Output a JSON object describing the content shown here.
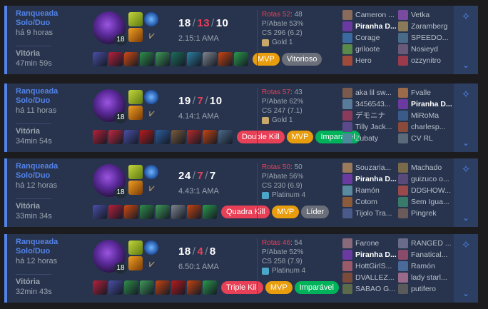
{
  "matches": [
    {
      "queue": "Ranqueada Solo/Duo",
      "ago": "há 9 horas",
      "result": "Vitória",
      "duration": "47min 59s",
      "level": "18",
      "kills": "18",
      "deaths": "13",
      "assists": "10",
      "ratio": "2.15:1 AMA",
      "badges": [
        {
          "label": "MVP",
          "class": "b-mvp"
        },
        {
          "label": "Vitorioso",
          "class": "b-gray"
        }
      ],
      "rotas_label": "Rotas 52",
      "rotas_rest": ": 48",
      "pabate": "P/Abate 53%",
      "cs": "CS 296 (6.2)",
      "rank": "Gold 1",
      "rank_color": "#c9a86b",
      "items": [
        "#4a4fa8",
        "#b8203a",
        "#d04a12",
        "#2e8e4a",
        "#3e9a58",
        "#1c6e5a",
        "#2c7fa0",
        "#7e8690",
        "#c84410",
        "#2a9a4c"
      ],
      "team1": [
        {
          "name": "Cameron ...",
          "c": "#8a6a5a"
        },
        {
          "name": "Piranha D...",
          "c": "#6a3aa0",
          "me": true
        },
        {
          "name": "Corage",
          "c": "#3a6aa0"
        },
        {
          "name": "griloote",
          "c": "#5a8a4a"
        },
        {
          "name": "Hero",
          "c": "#a04a3a"
        }
      ],
      "team2": [
        {
          "name": "Vetka",
          "c": "#7a4aa0"
        },
        {
          "name": "Zaramberg",
          "c": "#8a7a5a"
        },
        {
          "name": "SPEEDO...",
          "c": "#4a6a8a"
        },
        {
          "name": "Nosieyd",
          "c": "#6a5a7a"
        },
        {
          "name": "ozzynitro",
          "c": "#9a3a4a"
        }
      ]
    },
    {
      "queue": "Ranqueada Solo/Duo",
      "ago": "há 11 horas",
      "result": "Vitória",
      "duration": "34min 54s",
      "level": "18",
      "kills": "19",
      "deaths": "7",
      "assists": "10",
      "ratio": "4.14:1 AMA",
      "badges": [
        {
          "label": "Double Kill",
          "class": "b-red"
        },
        {
          "label": "MVP",
          "class": "b-mvp"
        },
        {
          "label": "Imparável",
          "class": "b-green"
        }
      ],
      "rotas_label": "Rotas 57",
      "rotas_rest": ": 43",
      "pabate": "P/Abate 62%",
      "cs": "CS 247 (7.1)",
      "rank": "Gold 1",
      "rank_color": "#c9a86b",
      "items": [
        "#b8203a",
        "#c2283e",
        "#4a4fa8",
        "#b81a1a",
        "#2c5ea0",
        "#7a5a3a",
        "#b82a2a",
        "#c84410",
        "#4a6a8a"
      ],
      "team1": [
        {
          "name": "aka lil sw...",
          "c": "#7a5a4a"
        },
        {
          "name": "3456543...",
          "c": "#5a7a9a"
        },
        {
          "name": "デモニナ",
          "c": "#8a3a5a"
        },
        {
          "name": "Tilly Jack...",
          "c": "#5a4a8a"
        },
        {
          "name": "Zubaty",
          "c": "#4a8a9a"
        }
      ],
      "team2": [
        {
          "name": "Fvalle",
          "c": "#9a6a4a"
        },
        {
          "name": "Piranha D...",
          "c": "#6a3aa0",
          "me": true
        },
        {
          "name": "MiRoMa",
          "c": "#3a5a8a"
        },
        {
          "name": "charlesp...",
          "c": "#8a4a3a"
        },
        {
          "name": "CV RL",
          "c": "#5a6a7a"
        }
      ]
    },
    {
      "queue": "Ranqueada Solo/Duo",
      "ago": "há 12 horas",
      "result": "Vitória",
      "duration": "33min 34s",
      "level": "18",
      "kills": "24",
      "deaths": "7",
      "assists": "7",
      "ratio": "4.43:1 AMA",
      "badges": [
        {
          "label": "Quadra Kill",
          "class": "b-red"
        },
        {
          "label": "MVP",
          "class": "b-mvp"
        },
        {
          "label": "Líder",
          "class": "b-gray"
        }
      ],
      "rotas_label": "Rotas 50",
      "rotas_rest": ": 50",
      "pabate": "P/Abate 56%",
      "cs": "CS 230 (6.9)",
      "rank": "Platinum 4",
      "rank_color": "#4aa7c9",
      "items": [
        "#4a4fa8",
        "#b8203a",
        "#d04a12",
        "#2e8e4a",
        "#3e9a58",
        "#7e8690",
        "#c84410",
        "#2a9a4c"
      ],
      "team1": [
        {
          "name": "Souzaria...",
          "c": "#9a7a5a"
        },
        {
          "name": "Piranha D...",
          "c": "#6a3aa0",
          "me": true
        },
        {
          "name": "Ramón",
          "c": "#5a8aa0"
        },
        {
          "name": "Cotom",
          "c": "#8a5a3a"
        },
        {
          "name": "Tijolo Tra...",
          "c": "#4a5a8a"
        }
      ],
      "team2": [
        {
          "name": "Machado",
          "c": "#7a6a4a"
        },
        {
          "name": "guizuco o...",
          "c": "#5a4a7a"
        },
        {
          "name": "DDSHOW...",
          "c": "#9a4a4a"
        },
        {
          "name": "Sem Igua...",
          "c": "#3a7a6a"
        },
        {
          "name": "Pingrek",
          "c": "#6a5a5a"
        }
      ]
    },
    {
      "queue": "Ranqueada Solo/Duo",
      "ago": "há 12 horas",
      "result": "Vitória",
      "duration": "32min 43s",
      "level": "18",
      "kills": "18",
      "deaths": "4",
      "assists": "8",
      "ratio": "6.50:1 AMA",
      "badges": [
        {
          "label": "Triple Kill",
          "class": "b-red"
        },
        {
          "label": "MVP",
          "class": "b-mvp"
        },
        {
          "label": "Imparável",
          "class": "b-green"
        }
      ],
      "rotas_label": "Rotas 46",
      "rotas_rest": ": 54",
      "pabate": "P/Abate 52%",
      "cs": "CS 258 (7.9)",
      "rank": "Platinum 4",
      "rank_color": "#4aa7c9",
      "items": [
        "#b8203a",
        "#4a4fa8",
        "#2e8e4a",
        "#3e9a58",
        "#c84410",
        "#b81a1a",
        "#c84410",
        "#2a9a4c"
      ],
      "team1": [
        {
          "name": "Farone",
          "c": "#8a6a7a"
        },
        {
          "name": "Piranha D...",
          "c": "#6a3aa0",
          "me": true
        },
        {
          "name": "HottGirlS...",
          "c": "#9a5a6a"
        },
        {
          "name": "DVALLEZ...",
          "c": "#7a4a3a"
        },
        {
          "name": "SABAO G...",
          "c": "#5a6a4a"
        }
      ],
      "team2": [
        {
          "name": "RANGED ...",
          "c": "#6a6a8a"
        },
        {
          "name": "Fanatical...",
          "c": "#8a4a6a"
        },
        {
          "name": "Ramón",
          "c": "#4a6a9a"
        },
        {
          "name": "lady starl...",
          "c": "#9a6a8a"
        },
        {
          "name": "putifero",
          "c": "#5a5a5a"
        }
      ]
    }
  ]
}
